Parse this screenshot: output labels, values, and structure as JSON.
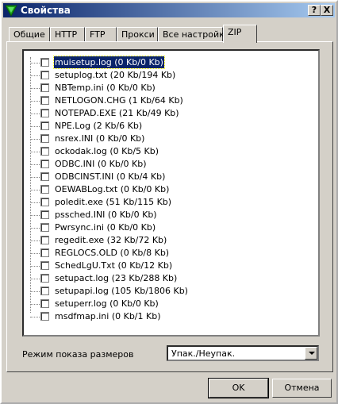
{
  "window": {
    "title": "Свойства",
    "help_label": "?",
    "close_label": "X"
  },
  "tabs": [
    {
      "label": "Общие"
    },
    {
      "label": "HTTP"
    },
    {
      "label": "FTP"
    },
    {
      "label": "Прокси"
    },
    {
      "label": "Все настройки"
    },
    {
      "label": "ZIP"
    }
  ],
  "active_tab": "ZIP",
  "files": [
    {
      "label": "muisetup.log (0 Kb/0 Kb)",
      "checked": false,
      "selected": true
    },
    {
      "label": "setuplog.txt (20 Kb/194 Kb)",
      "checked": false
    },
    {
      "label": "NBTemp.ini (0 Kb/0 Kb)",
      "checked": false
    },
    {
      "label": "NETLOGON.CHG (1 Kb/64 Kb)",
      "checked": false
    },
    {
      "label": "NOTEPAD.EXE (21 Kb/49 Kb)",
      "checked": false
    },
    {
      "label": "NPE.Log (2 Kb/6 Kb)",
      "checked": false
    },
    {
      "label": "nsrex.INI (0 Kb/0 Kb)",
      "checked": false
    },
    {
      "label": "ockodak.log (0 Kb/5 Kb)",
      "checked": false
    },
    {
      "label": "ODBC.INI (0 Kb/0 Kb)",
      "checked": false
    },
    {
      "label": "ODBCINST.INI (0 Kb/4 Kb)",
      "checked": false
    },
    {
      "label": "OEWABLog.txt (0 Kb/0 Kb)",
      "checked": false
    },
    {
      "label": "poledit.exe (51 Kb/115 Kb)",
      "checked": false
    },
    {
      "label": "pssched.INI (0 Kb/0 Kb)",
      "checked": false
    },
    {
      "label": "Pwrsync.ini (0 Kb/0 Kb)",
      "checked": false
    },
    {
      "label": "regedit.exe (32 Kb/72 Kb)",
      "checked": false
    },
    {
      "label": "REGLOCS.OLD (0 Kb/8 Kb)",
      "checked": false
    },
    {
      "label": "SchedLgU.Txt (0 Kb/12 Kb)",
      "checked": false
    },
    {
      "label": "setupact.log (23 Kb/288 Kb)",
      "checked": false
    },
    {
      "label": "setupapi.log (105 Kb/1806 Kb)",
      "checked": false
    },
    {
      "label": "setuperr.log (0 Kb/0 Kb)",
      "checked": false
    },
    {
      "label": "msdfmap.ini (0 Kb/1 Kb)",
      "checked": false
    }
  ],
  "size_mode": {
    "label": "Режим показа размеров",
    "value": "Упак./Неупак."
  },
  "buttons": {
    "ok": "OK",
    "cancel": "Отмена"
  },
  "colors": {
    "selection": "#0a246a",
    "titlebar": "#0a246a",
    "face": "#d4d0c8"
  },
  "icons": {
    "app": "green-down-arrow-icon"
  }
}
